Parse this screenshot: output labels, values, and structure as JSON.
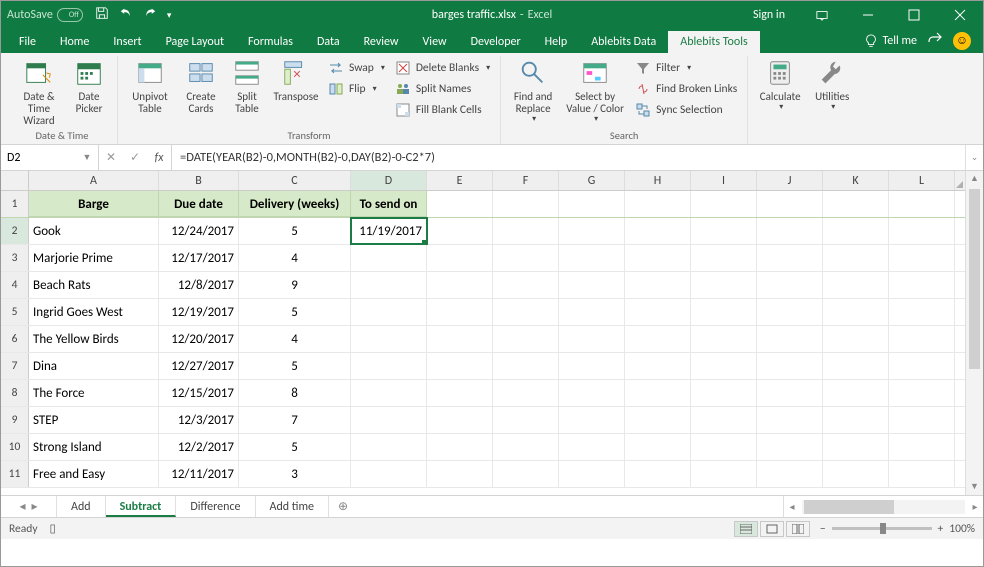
{
  "titlebar": {
    "autosave": "AutoSave",
    "filename": "barges traffic.xlsx",
    "appsep": "-",
    "app": "Excel",
    "signin": "Sign in"
  },
  "tabs": [
    "File",
    "Home",
    "Insert",
    "Page Layout",
    "Formulas",
    "Data",
    "Review",
    "View",
    "Developer",
    "Help",
    "Ablebits Data",
    "Ablebits Tools"
  ],
  "activeTab": 11,
  "tellme": "Tell me",
  "ribbon": {
    "dateTime": {
      "dateTimeWizard": "Date & Time Wizard",
      "datePicker": "Date Picker",
      "group": "Date & Time"
    },
    "transform": {
      "unpivot": "Unpivot Table",
      "createCards": "Create Cards",
      "splitTable": "Split Table",
      "transpose": "Transpose",
      "swap": "Swap",
      "flip": "Flip",
      "deleteBlanks": "Delete Blanks",
      "splitNames": "Split Names",
      "fillBlank": "Fill Blank Cells",
      "group": "Transform"
    },
    "search": {
      "findReplace": "Find and Replace",
      "selectBy": "Select by Value / Color",
      "filter": "Filter",
      "findBroken": "Find Broken Links",
      "syncSel": "Sync Selection",
      "group": "Search"
    },
    "calc": {
      "calculate": "Calculate",
      "utilities": "Utilities"
    }
  },
  "namebox": "D2",
  "formula": "=DATE(YEAR(B2)-0,MONTH(B2)-0,DAY(B2)-0-C2*7)",
  "cols": [
    "A",
    "B",
    "C",
    "D",
    "E",
    "F",
    "G",
    "H",
    "I",
    "J",
    "K",
    "L"
  ],
  "headers": {
    "A": "Barge",
    "B": "Due date",
    "C": "Delivery (weeks)",
    "D": "To send on"
  },
  "rows": [
    {
      "n": 2,
      "A": "Gook",
      "B": "12/24/2017",
      "C": "5",
      "D": "11/19/2017"
    },
    {
      "n": 3,
      "A": "Marjorie Prime",
      "B": "12/17/2017",
      "C": "4"
    },
    {
      "n": 4,
      "A": "Beach Rats",
      "B": "12/8/2017",
      "C": "9"
    },
    {
      "n": 5,
      "A": "Ingrid Goes West",
      "B": "12/19/2017",
      "C": "5"
    },
    {
      "n": 6,
      "A": "The Yellow Birds",
      "B": "12/20/2017",
      "C": "4"
    },
    {
      "n": 7,
      "A": "Dina",
      "B": "12/27/2017",
      "C": "5"
    },
    {
      "n": 8,
      "A": "The Force",
      "B": "12/15/2017",
      "C": "8"
    },
    {
      "n": 9,
      "A": "STEP",
      "B": "12/3/2017",
      "C": "7"
    },
    {
      "n": 10,
      "A": "Strong Island",
      "B": "12/2/2017",
      "C": "5"
    },
    {
      "n": 11,
      "A": "Free and Easy",
      "B": "12/11/2017",
      "C": "3"
    }
  ],
  "sheets": [
    "Add",
    "Subtract",
    "Difference",
    "Add time"
  ],
  "activeSheet": 1,
  "status": {
    "ready": "Ready",
    "zoom": "100%"
  }
}
